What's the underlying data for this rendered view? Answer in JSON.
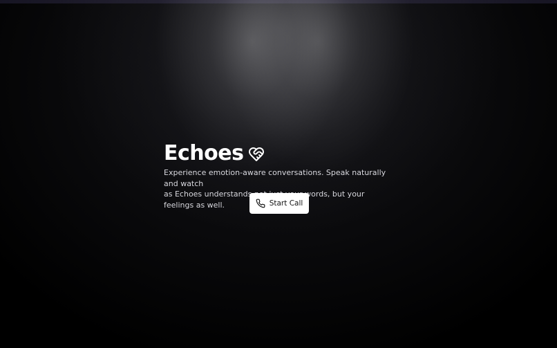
{
  "hero": {
    "title": "Echoes",
    "title_icon": "heart-handshake-icon",
    "subtitle_line1": "Experience emotion-aware conversations. Speak naturally and watch",
    "subtitle_line2": "as Echoes understands not just your words, but your feelings as well."
  },
  "actions": {
    "start_call_label": "Start Call",
    "start_call_icon": "phone-icon"
  },
  "colors": {
    "background": "#000000",
    "title": "#ffffff",
    "subtitle": "#d8d8de",
    "button_bg": "#ffffff",
    "button_text": "#111111"
  }
}
